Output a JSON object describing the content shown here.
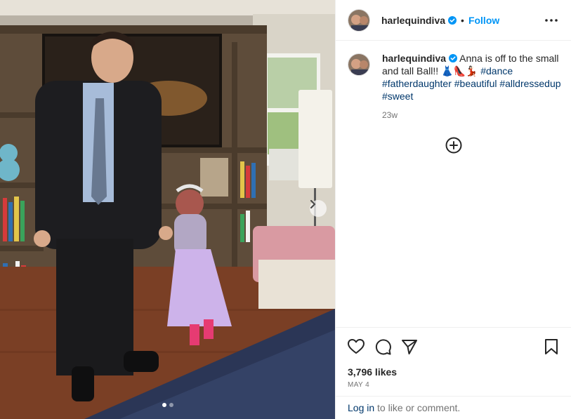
{
  "header": {
    "username": "harlequindiva",
    "separator": "•",
    "follow_label": "Follow",
    "more_icon": "more-horizontal-icon"
  },
  "caption": {
    "username": "harlequindiva",
    "text": "Anna is off to the small and tall Ball!! 👗👠💃🏻",
    "hashtags": [
      "#dance",
      "#fatherdaughter",
      "#beautiful",
      "#alldressedup",
      "#sweet"
    ],
    "time_ago": "23w"
  },
  "media": {
    "description_alt": "photo",
    "carousel_index": 1,
    "carousel_count": 2
  },
  "actions": {
    "like_icon": "heart-icon",
    "comment_icon": "comment-icon",
    "share_icon": "share-icon",
    "save_icon": "bookmark-icon",
    "add_icon": "plus-circle-icon"
  },
  "stats": {
    "likes": "3,796 likes",
    "date": "MAY 4"
  },
  "login": {
    "link": "Log in",
    "rest": " to like or comment."
  },
  "colors": {
    "accent": "#0095f6",
    "hashtag": "#00376b",
    "secondary_text": "#737373",
    "border": "#efefef"
  }
}
